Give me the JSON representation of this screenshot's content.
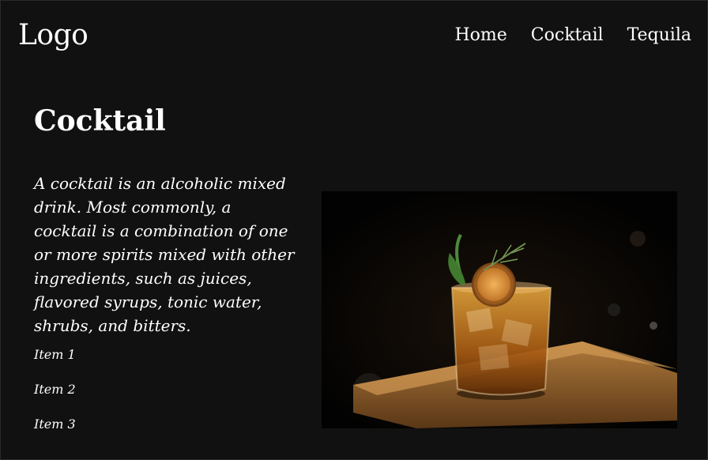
{
  "header": {
    "logo": "Logo",
    "nav": [
      {
        "label": "Home"
      },
      {
        "label": "Cocktail"
      },
      {
        "label": "Tequila"
      }
    ]
  },
  "main": {
    "title": "Cocktail",
    "description": "A cocktail is an alcoholic mixed drink. Most commonly, a cocktail is a combination of one or more spirits mixed with other ingredients, such as juices, flavored syrups, tonic water, shrubs, and bitters.",
    "items": [
      {
        "label": "Item 1"
      },
      {
        "label": "Item 2"
      },
      {
        "label": "Item 3"
      }
    ],
    "image": {
      "subject": "cocktail-glass-photo"
    }
  },
  "colors": {
    "background": "#111111",
    "text": "#ffffff",
    "accent_amber": "#c8781a"
  }
}
